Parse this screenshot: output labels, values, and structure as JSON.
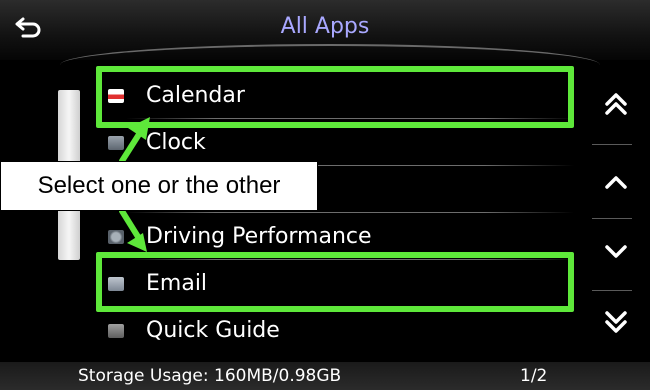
{
  "header": {
    "title": "All Apps"
  },
  "list": {
    "items": [
      {
        "label": "Calendar",
        "icon": "calendar-icon"
      },
      {
        "label": "Clock",
        "icon": "clock-icon"
      },
      {
        "label": "",
        "icon": ""
      },
      {
        "label": "Driving Performance",
        "icon": "driving-performance-icon"
      },
      {
        "label": "Email",
        "icon": "email-icon"
      },
      {
        "label": "Quick Guide",
        "icon": "quick-guide-icon"
      }
    ]
  },
  "controls": {
    "page_up_fast": "double-chevron-up-icon",
    "scroll_up": "chevron-up-icon",
    "scroll_down": "chevron-down-icon",
    "page_down_fast": "double-chevron-down-icon"
  },
  "footer": {
    "storage_usage": "Storage Usage: 160MB/0.98GB",
    "page_indicator": "1/2"
  },
  "annotation": {
    "callout_text": "Select one or the other",
    "highlight_color": "#5ee83a"
  },
  "colors": {
    "title": "#a9a8ff",
    "background": "#000000",
    "text": "#ffffff"
  }
}
